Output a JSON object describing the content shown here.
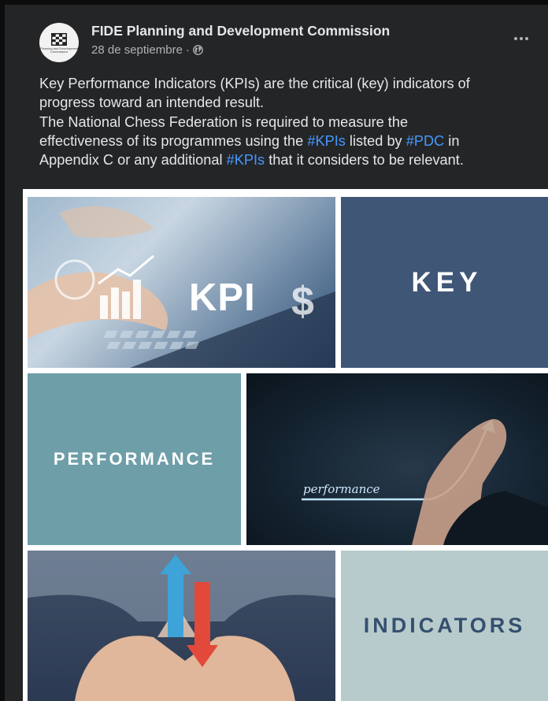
{
  "post": {
    "page_name": "FIDE Planning and Development Commission",
    "date": "28 de septiembre",
    "separator": "·",
    "avatar_caption": "Planning and Development Commission",
    "text": {
      "line1": "Key Performance Indicators (KPIs)  are the critical (key) indicators of",
      "line2": "progress toward an intended result.",
      "line3": "The National Chess Federation is required to measure the",
      "line4_a": "effectiveness of its programmes using the ",
      "line4_tag1": "#KPIs",
      "line4_b": " listed by ",
      "line4_tag2": "#PDC",
      "line4_c": " in",
      "line5_a": "Appendix C or any additional ",
      "line5_tag": "#KPIs",
      "line5_b": " that it considers to be relevant."
    }
  },
  "collage": {
    "kpi_word": "KPI",
    "key": "KEY",
    "performance": "PERFORMANCE",
    "performance_script": "performance",
    "indicators": "INDICATORS"
  },
  "colors": {
    "background": "#242526",
    "text": "#e4e6eb",
    "secondary_text": "#b0b3b8",
    "hashtag": "#4599ff",
    "key_tile": "#3f5677",
    "performance_tile": "#6e9ea8",
    "indicators_tile": "#b8cbcc",
    "indicators_text": "#35506f"
  },
  "icons": {
    "privacy": "globe-icon",
    "menu": "more-options-icon",
    "avatar_logo": "chessboard-icon"
  }
}
